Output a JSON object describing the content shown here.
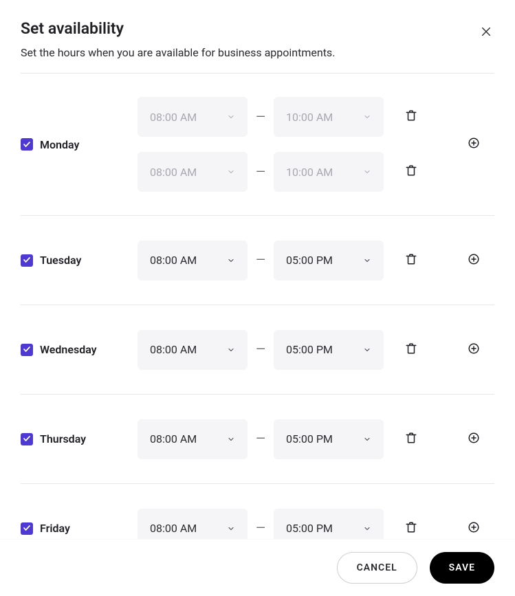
{
  "header": {
    "title": "Set availability",
    "subtitle": "Set the hours when you are available for business appointments."
  },
  "separator": "—",
  "days": [
    {
      "name": "Monday",
      "checked": true,
      "slots": [
        {
          "start": "08:00 AM",
          "end": "10:00 AM",
          "disabled": true
        },
        {
          "start": "08:00 AM",
          "end": "10:00 AM",
          "disabled": true
        }
      ]
    },
    {
      "name": "Tuesday",
      "checked": true,
      "slots": [
        {
          "start": "08:00 AM",
          "end": "05:00 PM",
          "disabled": false
        }
      ]
    },
    {
      "name": "Wednesday",
      "checked": true,
      "slots": [
        {
          "start": "08:00 AM",
          "end": "05:00 PM",
          "disabled": false
        }
      ]
    },
    {
      "name": "Thursday",
      "checked": true,
      "slots": [
        {
          "start": "08:00 AM",
          "end": "05:00 PM",
          "disabled": false
        }
      ]
    },
    {
      "name": "Friday",
      "checked": true,
      "slots": [
        {
          "start": "08:00 AM",
          "end": "05:00 PM",
          "disabled": false
        }
      ]
    }
  ],
  "footer": {
    "cancel_label": "Cancel",
    "save_label": "Save"
  }
}
